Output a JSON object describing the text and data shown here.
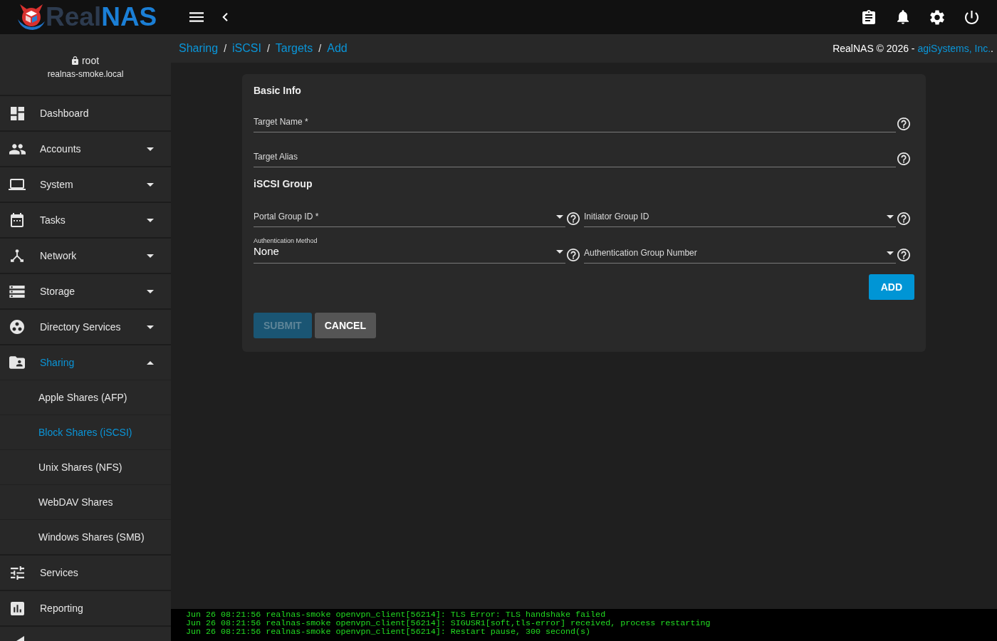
{
  "topbar": {
    "logo": {
      "parts": [
        "Real",
        "NAS"
      ]
    }
  },
  "sidebar": {
    "user": {
      "name": "root",
      "host": "realnas-smoke.local"
    },
    "items": [
      {
        "label": "Dashboard",
        "selected": false
      },
      {
        "label": "Accounts",
        "selected": false,
        "expanded": false
      },
      {
        "label": "System",
        "selected": false,
        "expanded": false
      },
      {
        "label": "Tasks",
        "selected": false,
        "expanded": false
      },
      {
        "label": "Network",
        "selected": false,
        "expanded": false
      },
      {
        "label": "Storage",
        "selected": false,
        "expanded": false
      },
      {
        "label": "Directory Services",
        "selected": false,
        "expanded": false
      },
      {
        "label": "Sharing",
        "selected": true,
        "expanded": true,
        "children": [
          {
            "label": "Apple Shares (AFP)",
            "selected": false
          },
          {
            "label": "Block Shares (iSCSI)",
            "selected": true
          },
          {
            "label": "Unix Shares (NFS)",
            "selected": false
          },
          {
            "label": "WebDAV Shares",
            "selected": false
          },
          {
            "label": "Windows Shares (SMB)",
            "selected": false
          }
        ]
      },
      {
        "label": "Services",
        "selected": false
      },
      {
        "label": "Reporting",
        "selected": false
      },
      {
        "kind": "cut"
      }
    ]
  },
  "breadcrumb": {
    "links": [
      "Sharing",
      "iSCSI",
      "Targets",
      "Add"
    ],
    "separators": [
      "/",
      "/",
      "/"
    ]
  },
  "copyright": {
    "text": "RealNAS © 2026 - ",
    "link": "agiSystems, Inc.",
    "end": "."
  },
  "form": {
    "sections": [
      {
        "title": "Basic Info",
        "fields": [
          {
            "kind": "text",
            "placeholder": "Target Name *"
          },
          {
            "kind": "text",
            "placeholder": "Target Alias"
          }
        ]
      },
      {
        "title": "iSCSI Group",
        "fields": [
          {
            "kind": "select",
            "placeholder": "Portal Group ID *"
          },
          {
            "kind": "select",
            "placeholder": "Initiator Group ID"
          },
          {
            "kind": "select",
            "label": "Authentication Method",
            "value": "None"
          },
          {
            "kind": "select",
            "placeholder": "Authentication Group Number"
          }
        ],
        "add_button": {
          "label": "ADD"
        }
      }
    ],
    "buttons": [
      {
        "label": "SUBMIT",
        "kind": "primary",
        "disabled": true
      },
      {
        "label": "CANCEL",
        "kind": "secondary",
        "disabled": false
      }
    ]
  },
  "console": {
    "lines": [
      "Jun 26 08:21:56 realnas-smoke openvpn_client[56214]: TLS Error: TLS handshake failed",
      "Jun 26 08:21:56 realnas-smoke openvpn_client[56214]: SIGUSR1[soft,tls-error] received, process restarting",
      "Jun 26 08:21:56 realnas-smoke openvpn_client[56214]: Restart pause, 300 second(s)"
    ]
  }
}
